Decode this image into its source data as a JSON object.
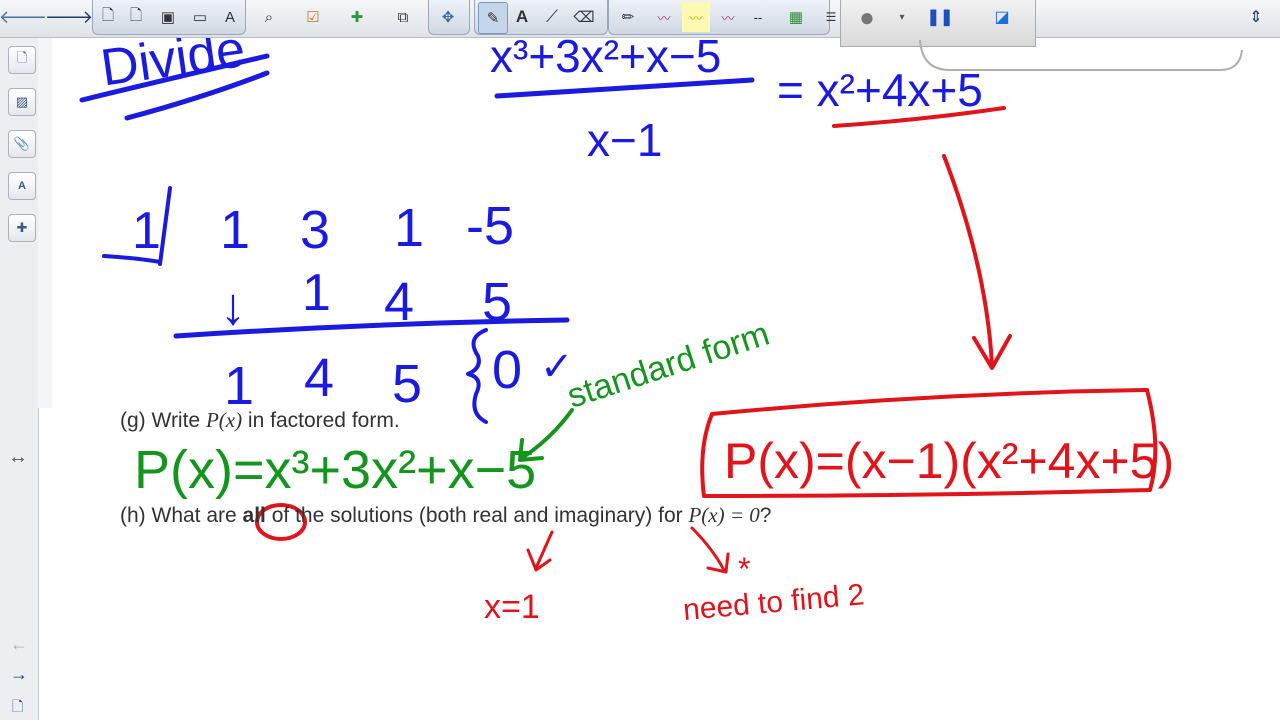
{
  "toolbar": {
    "icons": [
      "back-arrow-icon",
      "forward-arrow-icon",
      "new-page-icon",
      "delete-page-icon",
      "save-icon",
      "screen-shade-icon",
      "text-icon",
      "magnifier-icon",
      "pen-tray-icon",
      "gallery-icon",
      "capture-icon",
      "select-icon",
      "pens-icon",
      "text-tool-icon",
      "line-icon",
      "eraser-icon",
      "highlighter-icon",
      "table-icon",
      "record-icon",
      "pause-icon",
      "fill-icon",
      "expand-icon"
    ]
  },
  "sidebar": {
    "tabs": [
      "page-sorter-icon",
      "gallery-tab-icon",
      "attachments-icon",
      "properties-icon",
      "addons-icon"
    ],
    "resize_label": "↔",
    "nav_prev": "←",
    "nav_next": "→"
  },
  "work": {
    "divide_label": "Divide",
    "fraction_numerator": "x³+3x²+x−5",
    "fraction_denominator": "x−1",
    "quotient": "= x²+4x+5",
    "synthetic": {
      "divisor": "1",
      "row1": [
        "1",
        "3",
        "1",
        "-5"
      ],
      "row2": [
        "↓",
        "1",
        "4",
        "5"
      ],
      "row3": [
        "1",
        "4",
        "5",
        "0"
      ],
      "check": "✓"
    },
    "standard_form_note": "standard form",
    "g_prefix": "(g) Write ",
    "g_math": "P(x)",
    "g_suffix": " in factored form.",
    "p_standard": "P(x)=x³+3x²+x−5",
    "p_factored": "P(x)=(x−1)(x²+4x+5)",
    "h_prefix": "(h) What are ",
    "h_circled": "all",
    "h_suffix": " of the solutions (both real and imaginary) for ",
    "h_math": "P(x) = 0",
    "h_end": "?",
    "x_equals": "x=1",
    "star": "*",
    "need_note": "need to find 2"
  },
  "colors": {
    "blue_ink": "#1a1ae0",
    "red_ink": "#e0141a",
    "green_ink": "#14961e",
    "text": "#333333"
  }
}
